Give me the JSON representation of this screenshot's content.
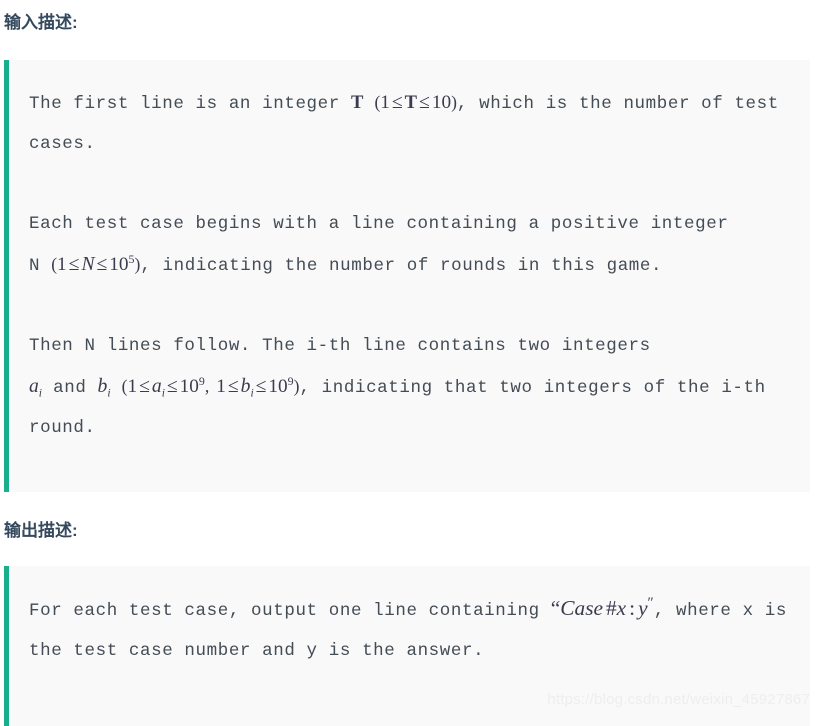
{
  "page": {
    "background_color": "#ffffff",
    "box_background_color": "#f9f9f9",
    "accent_color": "#1aaf8b",
    "heading_color": "#34495e",
    "body_text_color": "#444c55"
  },
  "input_section": {
    "heading": "输入描述:",
    "paragraphs": [
      {
        "id": "p1",
        "segments": [
          {
            "type": "text",
            "value": "The first line is an integer "
          },
          {
            "type": "math",
            "value": "T"
          },
          {
            "type": "text",
            "value": " "
          },
          {
            "type": "math",
            "value": "(1 ≤ T ≤ 10)"
          },
          {
            "type": "text",
            "value": ", which is the number of test cases."
          }
        ],
        "plain": "The first line is an integer T (1 ≤ T ≤ 10), which is the number of test cases."
      },
      {
        "id": "p2",
        "segments": [
          {
            "type": "text",
            "value": "Each test case begins with a line containing a positive integer N "
          },
          {
            "type": "math",
            "value": "(1 ≤ N ≤ 10^5)"
          },
          {
            "type": "text",
            "value": ", indicating the number of rounds in this game."
          }
        ],
        "plain": "Each test case begins with a line containing a positive integer N (1 ≤ N ≤ 10^5), indicating the number of rounds in this game."
      },
      {
        "id": "p3",
        "segments": [
          {
            "type": "text",
            "value": "Then N lines follow. The i-th line contains two integers "
          },
          {
            "type": "math",
            "value": "a_i"
          },
          {
            "type": "text",
            "value": " and "
          },
          {
            "type": "math",
            "value": "b_i"
          },
          {
            "type": "text",
            "value": " "
          },
          {
            "type": "math",
            "value": "(1 ≤ a_i ≤ 10^9, 1 ≤ b_i ≤ 10^9)"
          },
          {
            "type": "text",
            "value": ", indicating that two integers of the i-th round."
          }
        ],
        "plain": "Then N lines follow. The i-th line contains two integers a_i and b_i (1 ≤ a_i ≤ 10^9, 1 ≤ b_i ≤ 10^9), indicating that two integers of the i-th round."
      }
    ],
    "text_parts": {
      "p1_lead": "The first line is an integer",
      "p1_tail": ", which is the",
      "p1_line2": "number of test cases.",
      "p2_lead": "Each test case begins with a line containing a positive",
      "p2_n_label": "integer N",
      "p2_tail": ", indicating the number of rounds",
      "p2_line3": "in this game.",
      "p3_lead": "Then N lines follow. The i-th line contains two integers",
      "p3_and": "and",
      "p3_tail": ", indicating that two",
      "p3_line3": "integers of the i-th round."
    },
    "math": {
      "T_bold": "T",
      "T_range_open": "(",
      "T_range_one": "1",
      "T_range_le1": "≤",
      "T_range_var": "T",
      "T_range_le2": "≤",
      "T_range_ten": "10",
      "T_range_close": ")",
      "N_open": "(",
      "N_one": "1",
      "N_le1": "≤",
      "N_var": "N",
      "N_le2": "≤",
      "N_base": "10",
      "N_exp": "5",
      "N_close": ")",
      "a_var": "a",
      "a_sub": "i",
      "b_var": "b",
      "b_sub": "i",
      "ab_open": "(",
      "ab_one1": "1",
      "ab_le1": "≤",
      "ab_le2": "≤",
      "ab_base1": "10",
      "ab_exp1": "9",
      "ab_comma": ",",
      "ab_one2": "1",
      "ab_le3": "≤",
      "ab_le4": "≤",
      "ab_base2": "10",
      "ab_exp2": "9",
      "ab_close": ")"
    }
  },
  "output_section": {
    "heading": "输出描述:",
    "paragraph": {
      "plain": "For each test case, output one line containing “Case #x : y”, where x is the test case number and y is the answer."
    },
    "text_parts": {
      "lead": "For each test case, output one line containing",
      "tail": ", where x is the test case number and y is",
      "line3": "the answer."
    },
    "math": {
      "open_quote": "“",
      "case_word": "Case",
      "hash": "#",
      "x_var": "x",
      "colon": ":",
      "y_var": "y",
      "close_prime": "″",
      "comma": ","
    }
  },
  "watermark": {
    "text": "https://blog.csdn.net/weixin_45927867"
  }
}
